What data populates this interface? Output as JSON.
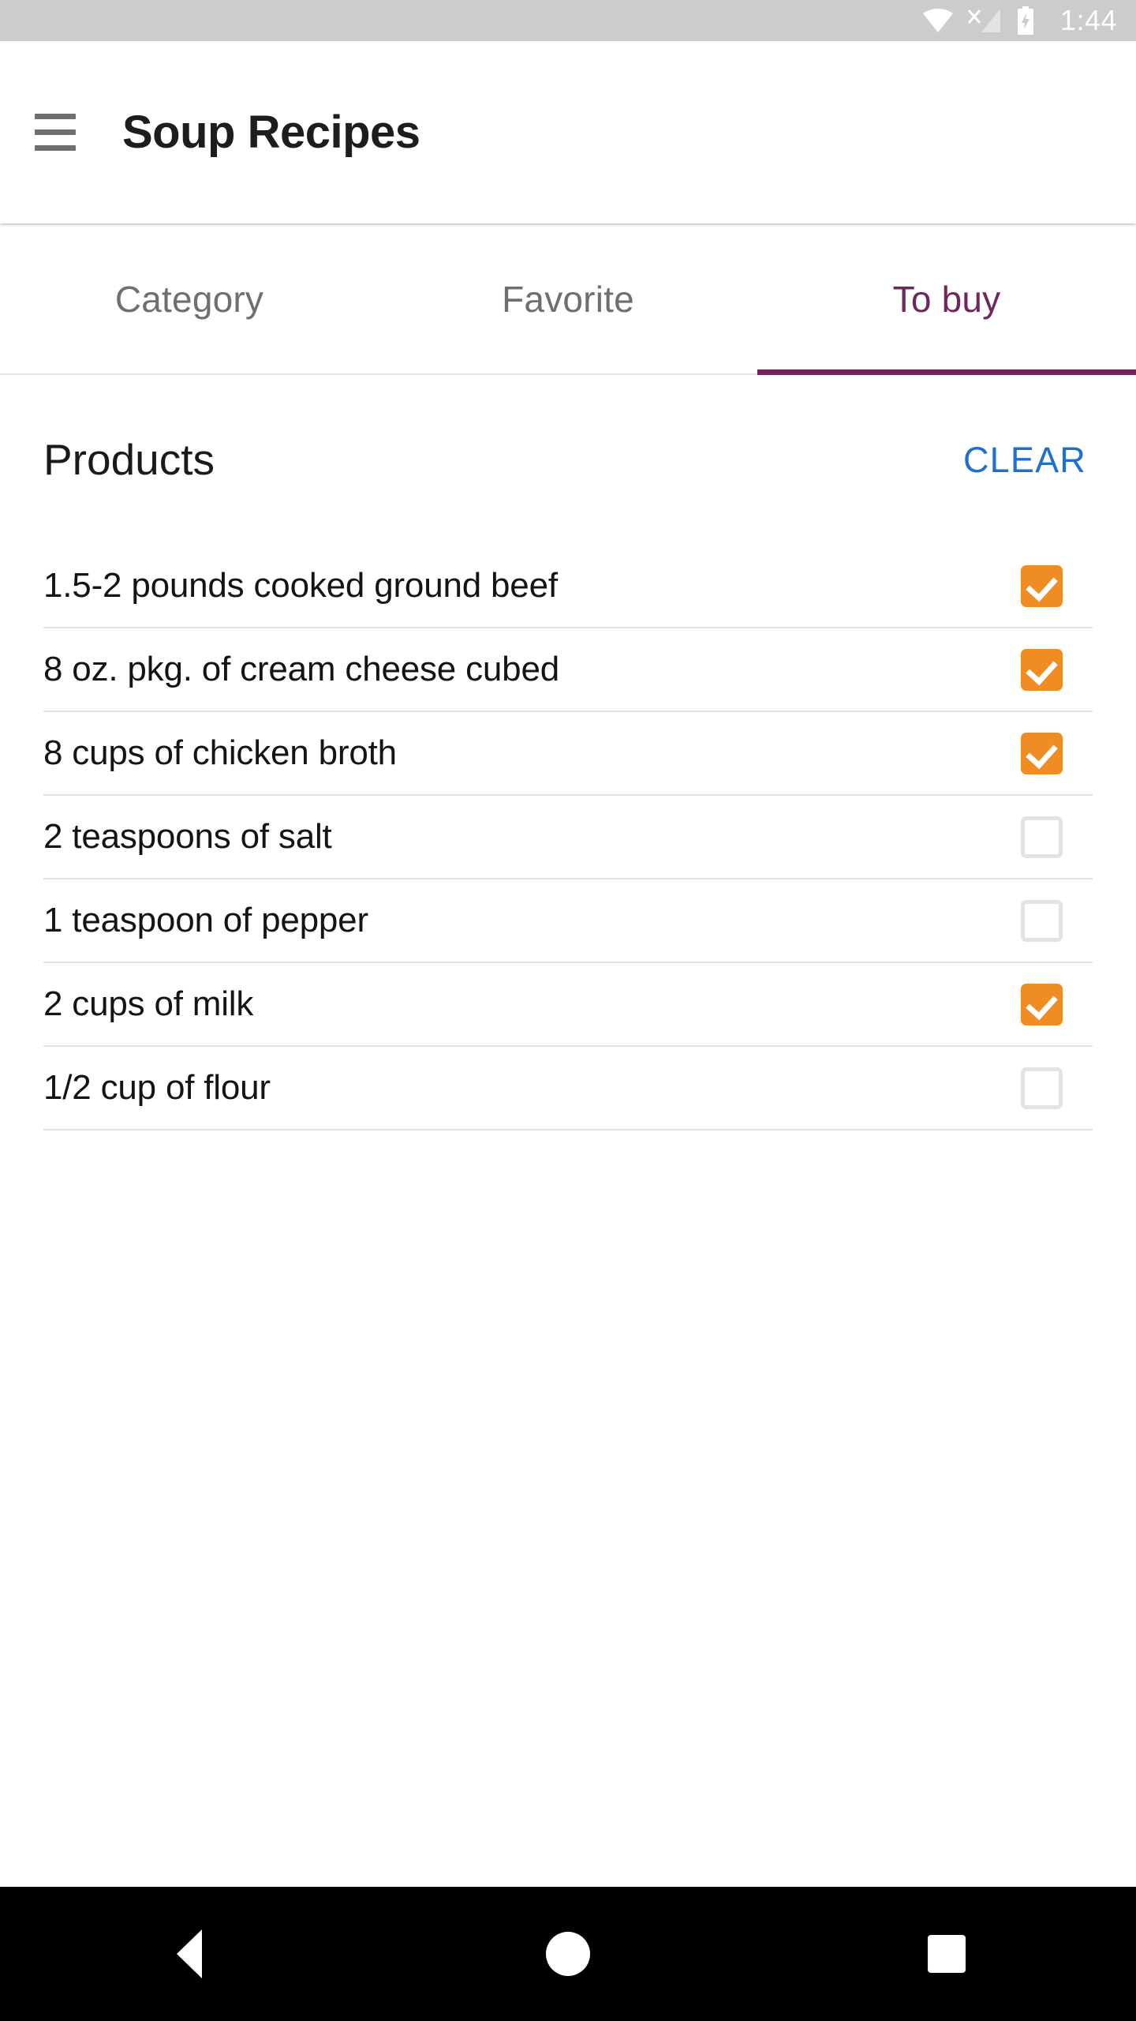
{
  "status_bar": {
    "time": "1:44",
    "icons": [
      "wifi-icon",
      "cell-signal-no-sim-icon",
      "battery-charging-icon"
    ],
    "background_color": "#cccccc"
  },
  "app_bar": {
    "menu_icon": "hamburger-menu-icon",
    "title": "Soup Recipes"
  },
  "tabs": {
    "items": [
      {
        "label": "Category",
        "active": false
      },
      {
        "label": "Favorite",
        "active": false
      },
      {
        "label": "To buy",
        "active": true
      }
    ],
    "active_color": "#70265a",
    "inactive_color": "#6f6f6f"
  },
  "products": {
    "title": "Products",
    "clear_label": "CLEAR",
    "clear_color": "#1f6fd0",
    "checked_color": "#ef8c23",
    "unchecked_border_color": "#e3e3e3",
    "items": [
      {
        "label": "1.5-2 pounds cooked ground beef",
        "checked": true
      },
      {
        "label": "8 oz. pkg. of cream cheese cubed",
        "checked": true
      },
      {
        "label": "8 cups of chicken broth",
        "checked": true
      },
      {
        "label": "2 teaspoons of salt",
        "checked": false
      },
      {
        "label": "1 teaspoon of pepper",
        "checked": false
      },
      {
        "label": "2 cups of milk",
        "checked": true
      },
      {
        "label": "1/2 cup of flour",
        "checked": false
      }
    ]
  },
  "navigation_bar": {
    "back_icon": "triangle-back-icon",
    "home_icon": "circle-home-icon",
    "recents_icon": "square-recents-icon",
    "background_color": "#000000"
  }
}
